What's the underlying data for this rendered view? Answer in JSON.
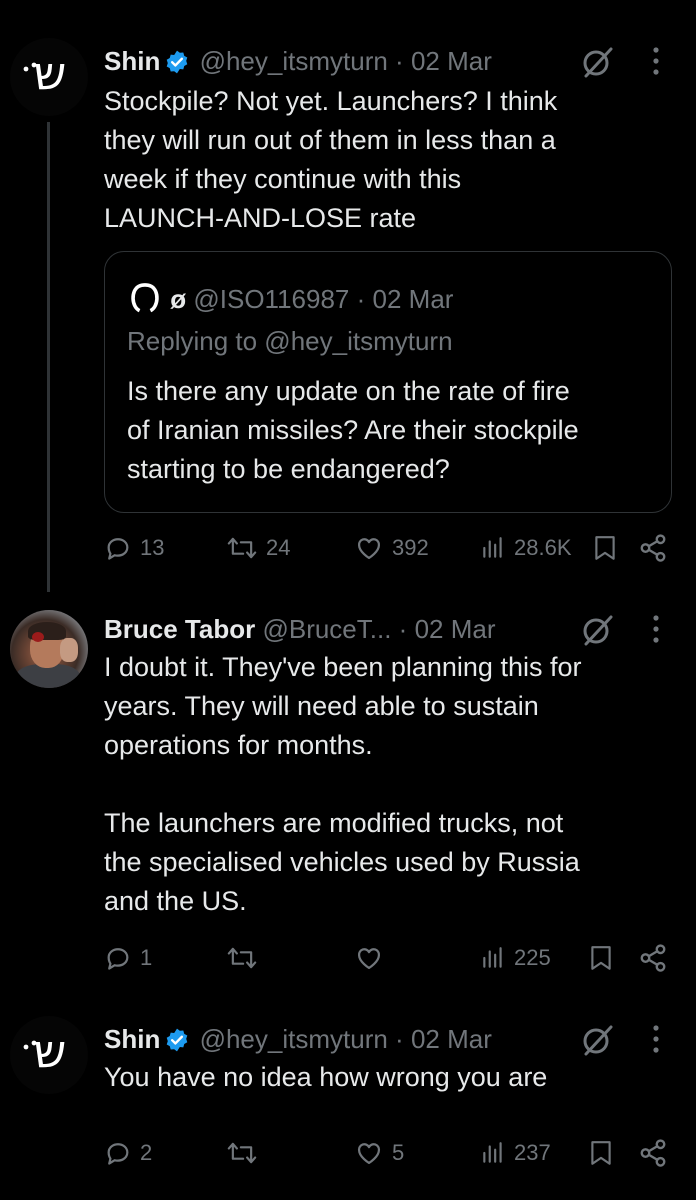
{
  "tweets": [
    {
      "name": "Shin",
      "handle": "@hey_itsmyturn",
      "separator": "·",
      "date": "02 Mar",
      "text": "Stockpile? Not yet. Launchers? I think\nthey will run out of them in less than a\nweek if they continue with this\nLAUNCH-AND-LOSE rate",
      "quote": {
        "name": "ø",
        "handle": "@ISO116987",
        "separator": "·",
        "date": "02 Mar",
        "replying": "Replying to @hey_itsmyturn",
        "text": "Is there any update on the rate of fire\nof Iranian missiles? Are their stockpile\nstarting to be endangered?"
      },
      "replies": "13",
      "reposts": "24",
      "likes": "392",
      "views": "28.6K"
    },
    {
      "name": "Bruce Tabor",
      "handle": "@BruceT...",
      "separator": "·",
      "date": "02 Mar",
      "text": "I doubt it. They've been planning this for\nyears. They will need able to sustain\noperations for months.\n\nThe launchers are modified trucks, not\nthe specialised vehicles used by Russia\nand the US.",
      "replies": "1",
      "reposts": "",
      "likes": "",
      "views": "225"
    },
    {
      "name": "Shin",
      "handle": "@hey_itsmyturn",
      "separator": "·",
      "date": "02 Mar",
      "text": "You have no idea how wrong you are",
      "replies": "2",
      "reposts": "",
      "likes": "5",
      "views": "237"
    }
  ],
  "icons": {
    "avatar_glyph": "ש",
    "accent": "#1d9bf0",
    "muted": "#71767b"
  }
}
